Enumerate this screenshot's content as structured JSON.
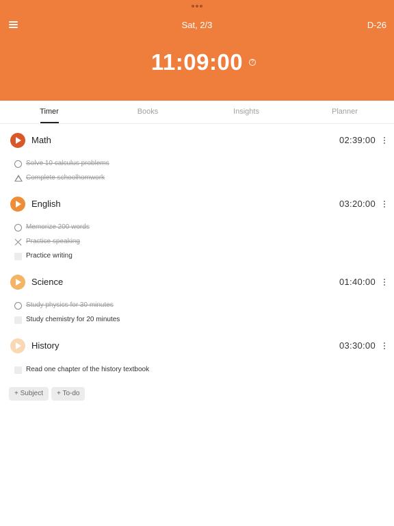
{
  "header": {
    "date": "Sat, 2/3",
    "dday": "D-26",
    "clock": "11:09:00",
    "help_glyph": "?",
    "background_color": "#EF7E3D"
  },
  "tabs": [
    {
      "label": "Timer",
      "active": true
    },
    {
      "label": "Books",
      "active": false
    },
    {
      "label": "Insights",
      "active": false
    },
    {
      "label": "Planner",
      "active": false
    }
  ],
  "subjects": [
    {
      "name": "Math",
      "time": "02:39:00",
      "color": "#D9582A",
      "todos": [
        {
          "text": "Solve 10 calculus problems",
          "done": true,
          "mark": "circle-icon"
        },
        {
          "text": "Complete schoolhomwork",
          "done": true,
          "mark": "triangle-icon"
        }
      ]
    },
    {
      "name": "English",
      "time": "03:20:00",
      "color": "#EF8C37",
      "todos": [
        {
          "text": "Memorize 200 words",
          "done": true,
          "mark": "circle-icon"
        },
        {
          "text": "Practice speaking",
          "done": true,
          "mark": "cross-icon"
        },
        {
          "text": "Practice writing",
          "done": false,
          "mark": "checkbox"
        }
      ]
    },
    {
      "name": "Science",
      "time": "01:40:00",
      "color": "#F3B565",
      "todos": [
        {
          "text": "Study physics for 30 minutes",
          "done": true,
          "mark": "circle-icon"
        },
        {
          "text": "Study chemistry for 20 minutes",
          "done": false,
          "mark": "checkbox"
        }
      ]
    },
    {
      "name": "History",
      "time": "03:30:00",
      "color": "#F9D9B3",
      "todos": [
        {
          "text": "Read one chapter of the history textbook",
          "done": false,
          "mark": "checkbox"
        }
      ]
    }
  ],
  "actions": {
    "add_subject": "+ Subject",
    "add_todo": "+ To-do"
  }
}
